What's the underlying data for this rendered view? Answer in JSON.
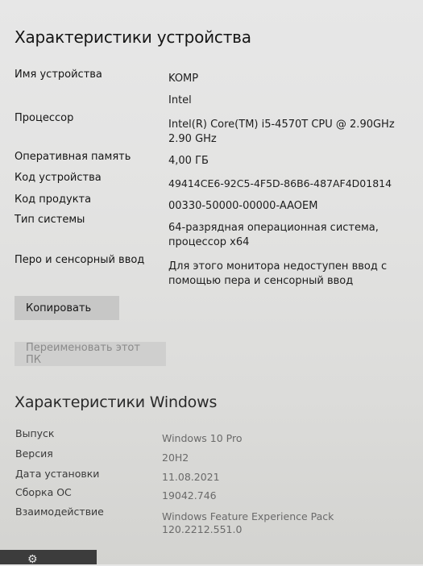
{
  "device": {
    "title": "Характеристики устройства",
    "rows": [
      {
        "label": "Имя устройства",
        "value": "KOMP"
      },
      {
        "label": "",
        "value": "Intel"
      },
      {
        "label": "Процессор",
        "value": "Intel(R) Core(TM) i5-4570T CPU @ 2.90GHz 2.90 GHz"
      },
      {
        "label": "Оперативная память",
        "value": "4,00 ГБ"
      },
      {
        "label": "Код устройства",
        "value": "49414CE6-92C5-4F5D-86B6-487AF4D01814"
      },
      {
        "label": "Код продукта",
        "value": "00330-50000-00000-AAOEM"
      },
      {
        "label": "Тип системы",
        "value": "64-разрядная операционная система, процессор x64"
      },
      {
        "label": "Перо и сенсорный ввод",
        "value": "Для этого монитора недоступен ввод с помощью пера и сенсорный ввод"
      }
    ],
    "copy_button": "Копировать",
    "rename_button": "Переименовать этот ПК"
  },
  "windows": {
    "title": "Характеристики Windows",
    "rows": [
      {
        "label": "Выпуск",
        "value": "Windows 10 Pro"
      },
      {
        "label": "Версия",
        "value": "20H2"
      },
      {
        "label": "Дата установки",
        "value": "11.08.2021"
      },
      {
        "label": "Сборка ОС",
        "value": "19042.746"
      },
      {
        "label": "Взаимодействие",
        "value": "Windows Feature Experience Pack 120.2212.551.0"
      }
    ]
  },
  "taskbar": {
    "icon": "gear-icon"
  }
}
